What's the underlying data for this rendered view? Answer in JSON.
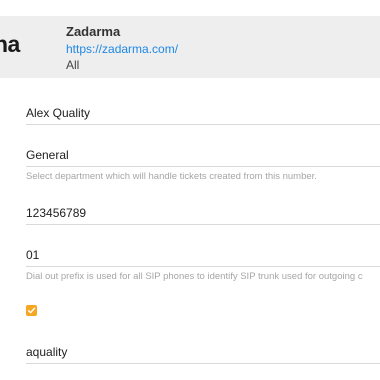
{
  "integration": {
    "logo_text": "na",
    "name": "Zadarma",
    "url": "https://zadarma.com/",
    "scope": "All"
  },
  "form": {
    "agent_name": "Alex Quality",
    "department": {
      "value": "General",
      "hint": "Select department which will handle tickets created from this number."
    },
    "phone_number": "123456789",
    "dial_out_prefix": {
      "value": "01",
      "hint": "Dial out prefix is used for all SIP phones to identify SIP trunk used for outgoing c"
    },
    "enabled": {
      "checked": true
    },
    "login": "aquality"
  },
  "colors": {
    "accent": "#f5a623",
    "link": "#1e88e5",
    "header_bg": "#eeeeee"
  }
}
